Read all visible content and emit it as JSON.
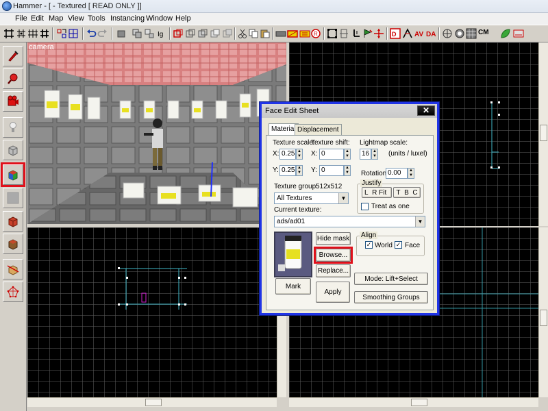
{
  "window": {
    "title": "Hammer - [ - Textured [ READ ONLY ]]"
  },
  "menu": [
    "File",
    "Edit",
    "Map",
    "View",
    "Tools",
    "Instancing",
    "Window",
    "Help"
  ],
  "toolbar": {
    "cm_label": "CM"
  },
  "left_tools": [
    "pointer-tool-icon",
    "magnify-tool-icon",
    "camera-tool-icon",
    "entity-tool-icon",
    "block-tool-icon",
    "texture-application-tool-icon",
    "apply-current-texture-icon",
    "decal-tool-icon",
    "overlay-tool-icon",
    "clipping-tool-icon",
    "vertex-tool-icon"
  ],
  "camera_view": {
    "label": "camera"
  },
  "dialog": {
    "title": "Face Edit Sheet",
    "close": "✕",
    "tabs": [
      "Material",
      "Displacement"
    ],
    "texture_scale": {
      "label": "Texture scale:",
      "x_label": "X:",
      "x": "0.25",
      "y_label": "Y:",
      "y": "0.25"
    },
    "texture_shift": {
      "label": "Texture shift:",
      "x_label": "X:",
      "x": "0",
      "y_label": "Y:",
      "y": "0"
    },
    "lightmap_scale": {
      "label": "Lightmap scale:",
      "value": "16",
      "units": "(units / luxel)"
    },
    "rotation": {
      "label": "Rotation:",
      "value": "0.00"
    },
    "justify": {
      "label": "Justify",
      "buttons": [
        "L",
        "R",
        "Fit",
        "T",
        "B",
        "C"
      ],
      "treat_as_one": "Treat as one",
      "treat_as_one_checked": false
    },
    "texture_group": {
      "label": "Texture group:",
      "size": "512x512",
      "value": "All Textures"
    },
    "current_texture": {
      "label": "Current texture:",
      "value": "ads/ad01"
    },
    "buttons": {
      "hide_mask": "Hide mask",
      "browse": "Browse...",
      "replace": "Replace...",
      "mark": "Mark",
      "apply": "Apply",
      "mode": "Mode: Lift+Select",
      "smoothing_groups": "Smoothing Groups"
    },
    "align": {
      "label": "Align",
      "world": "World",
      "world_checked": true,
      "face": "Face",
      "face_checked": true
    }
  }
}
